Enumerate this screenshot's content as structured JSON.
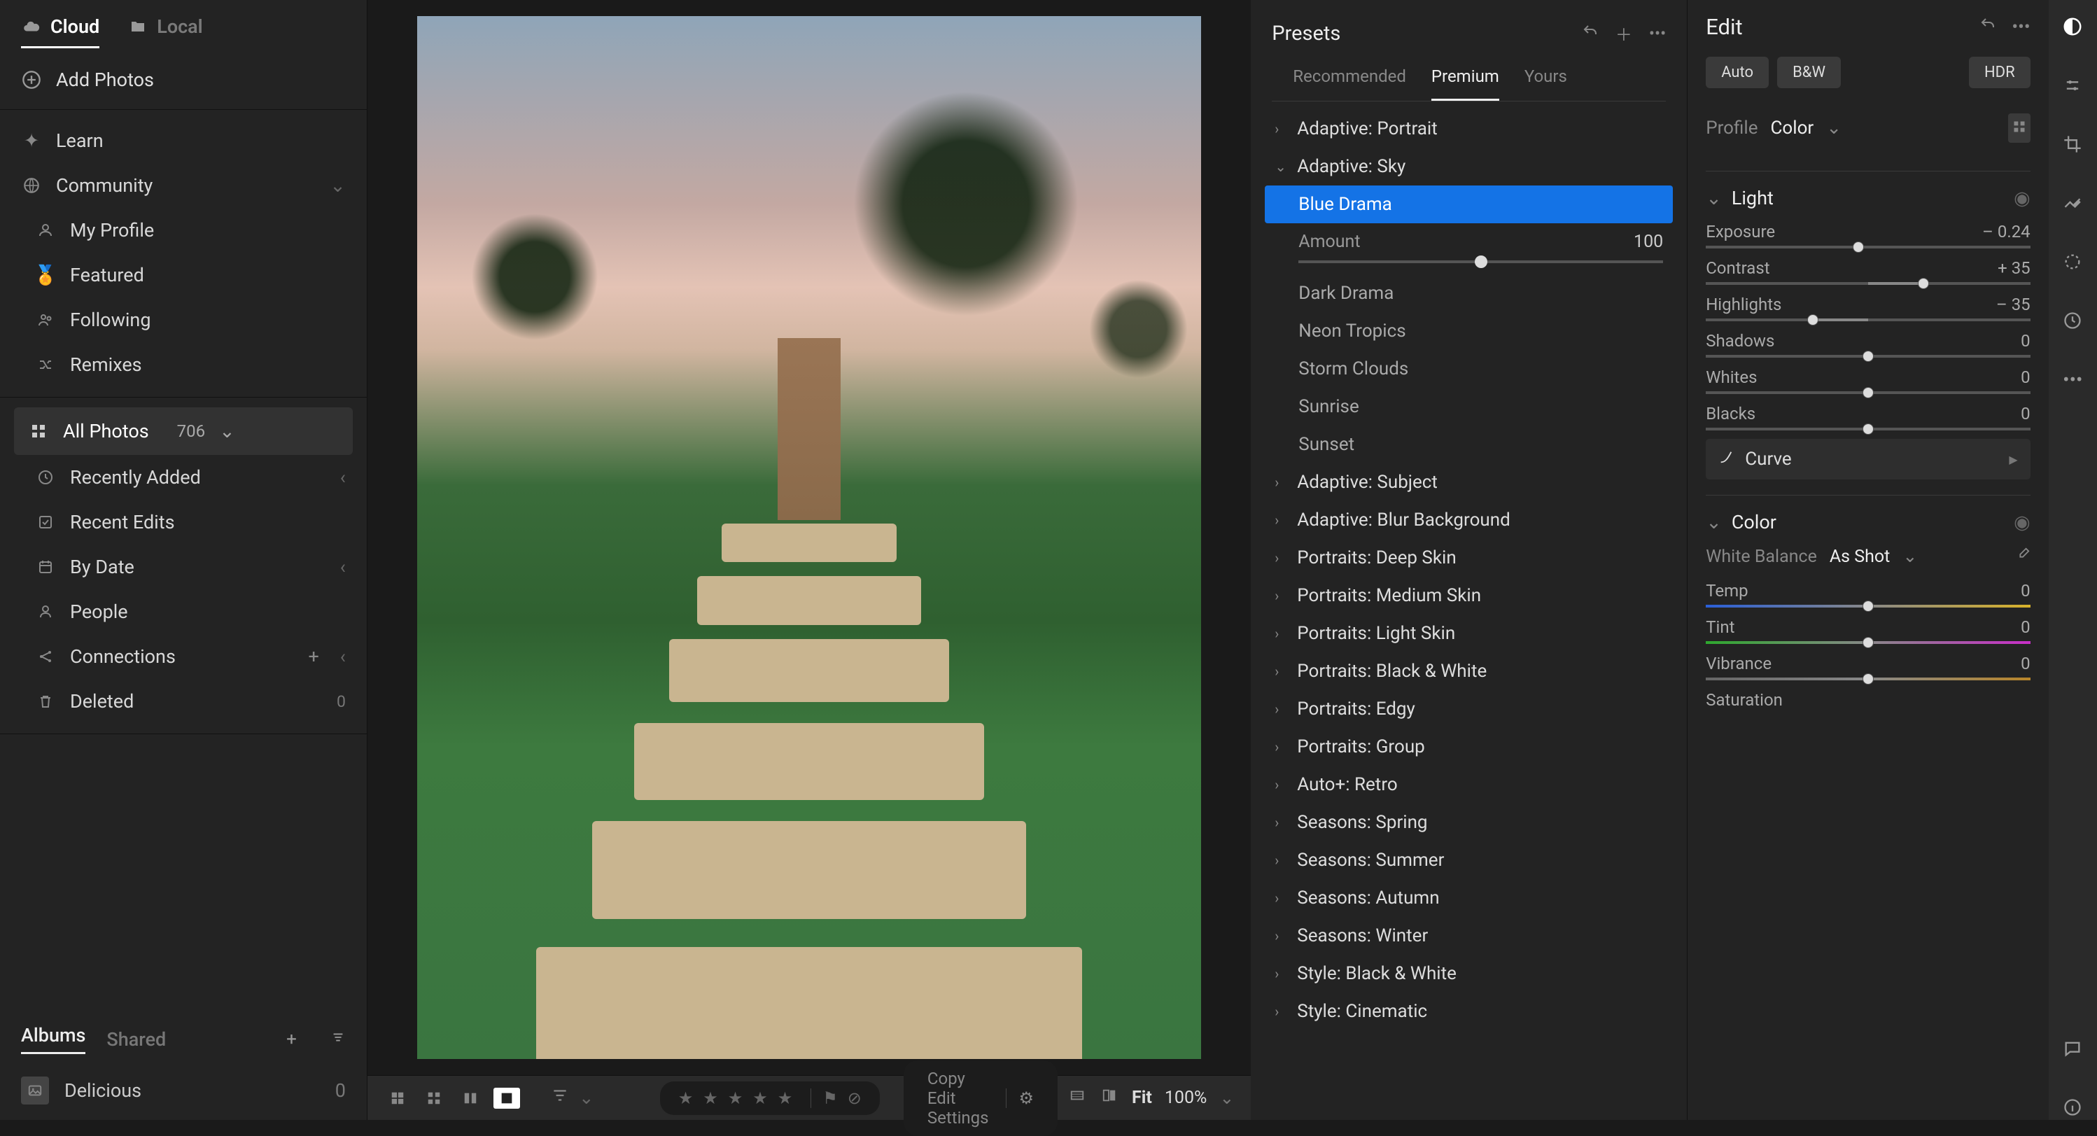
{
  "topTabs": {
    "cloud": "Cloud",
    "local": "Local"
  },
  "addPhotos": "Add Photos",
  "sidebar": {
    "learn": "Learn",
    "community": "Community",
    "myProfile": "My Profile",
    "featured": "Featured",
    "following": "Following",
    "remixes": "Remixes",
    "allPhotos": "All Photos",
    "allPhotosCount": "706",
    "recentlyAdded": "Recently Added",
    "recentEdits": "Recent Edits",
    "byDate": "By Date",
    "people": "People",
    "connections": "Connections",
    "deleted": "Deleted",
    "deletedCount": "0"
  },
  "albums": {
    "tabAlbums": "Albums",
    "tabShared": "Shared",
    "item": "Delicious",
    "itemCount": "0"
  },
  "bottom": {
    "copyEdit": "Copy Edit Settings",
    "fit": "Fit",
    "zoom": "100%"
  },
  "presets": {
    "title": "Presets",
    "tabs": {
      "rec": "Recommended",
      "prem": "Premium",
      "yours": "Yours"
    },
    "groups": {
      "adaptivePortrait": "Adaptive: Portrait",
      "adaptiveSky": "Adaptive: Sky",
      "adaptiveSubject": "Adaptive: Subject",
      "adaptiveBlur": "Adaptive: Blur Background",
      "portraitsDeep": "Portraits: Deep Skin",
      "portraitsMedium": "Portraits: Medium Skin",
      "portraitsLight": "Portraits: Light Skin",
      "portraitsBW": "Portraits: Black & White",
      "portraitsEdgy": "Portraits: Edgy",
      "portraitsGroup": "Portraits: Group",
      "autoPlusRetro": "Auto+: Retro",
      "seasonsSpring": "Seasons: Spring",
      "seasonsSummer": "Seasons: Summer",
      "seasonsAutumn": "Seasons: Autumn",
      "seasonsWinter": "Seasons: Winter",
      "styleBW": "Style: Black & White",
      "styleCinematic": "Style: Cinematic"
    },
    "skyItems": {
      "blueDrama": "Blue Drama",
      "darkDrama": "Dark Drama",
      "neonTropics": "Neon Tropics",
      "stormClouds": "Storm Clouds",
      "sunrise": "Sunrise",
      "sunset": "Sunset"
    },
    "amount": "Amount",
    "amountVal": "100"
  },
  "edit": {
    "title": "Edit",
    "auto": "Auto",
    "bw": "B&W",
    "hdr": "HDR",
    "profileLbl": "Profile",
    "profileVal": "Color",
    "light": "Light",
    "exposure": "Exposure",
    "exposureVal": "– 0.24",
    "contrast": "Contrast",
    "contrastVal": "+ 35",
    "highlights": "Highlights",
    "highlightsVal": "– 35",
    "shadows": "Shadows",
    "shadowsVal": "0",
    "whites": "Whites",
    "whitesVal": "0",
    "blacks": "Blacks",
    "blacksVal": "0",
    "curve": "Curve",
    "color": "Color",
    "wbLbl": "White Balance",
    "wbVal": "As Shot",
    "temp": "Temp",
    "tempVal": "0",
    "tint": "Tint",
    "tintVal": "0",
    "vibrance": "Vibrance",
    "vibranceVal": "0",
    "saturation": "Saturation"
  }
}
